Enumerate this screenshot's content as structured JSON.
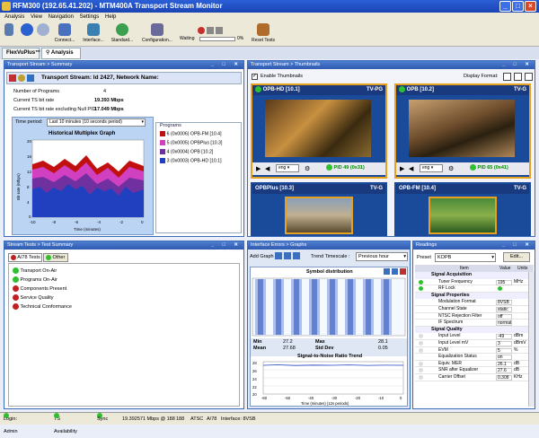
{
  "window": {
    "title": "RFM300 (192.65.41.202) - MTM400A Transport Stream Monitor"
  },
  "menu": [
    "Analysis",
    "View",
    "Navigation",
    "Settings",
    "Help"
  ],
  "toolbar": {
    "connect": "Connect...",
    "interface": "Interface...",
    "standard": "Standard...",
    "configuration": "Configuration...",
    "reset": "Reset Tests",
    "waiting": "Waiting",
    "progress": "0%"
  },
  "tabs": {
    "flexvuplus": "FlexVuPlus™",
    "analysis": "Analysis"
  },
  "summary": {
    "header": "Transport Stream > Summary",
    "ts_title": "Transport Stream: Id 2427, Network Name:",
    "rows": [
      {
        "label": "Number of Programs",
        "value": "4"
      },
      {
        "label": "Current TS bit rate",
        "value": "19.393 Mbps"
      },
      {
        "label": "Current TS bit rate excluding Null PID",
        "value": "17.049 Mbps"
      }
    ],
    "time_period_label": "Time period:",
    "time_period_value": "Last 10 minutes (10 seconds period)",
    "graph_title": "Historical Multiplex Graph",
    "ylabel": "Bit-rate (Mbps)",
    "xlabel": "Time (minutes)",
    "programs_label": "Programs",
    "programs": [
      {
        "label": "6 (0x0006) OPB-FM [10.4]",
        "color": "#c01010"
      },
      {
        "label": "5 (0x0005) OPBPlus [10.3]",
        "color": "#d040c0"
      },
      {
        "label": "4 (0x0004) OPB [10.2]",
        "color": "#7030a0"
      },
      {
        "label": "3 (0x0003) OPB-HD [10.1]",
        "color": "#2040c0"
      }
    ],
    "yticks": [
      "20",
      "18",
      "16",
      "14",
      "12",
      "10",
      "8",
      "6",
      "4",
      "2",
      "0"
    ],
    "xticks": [
      "-10",
      "-9",
      "-8",
      "-7",
      "-6",
      "-5",
      "-4",
      "-3",
      "-2",
      "-1",
      "0"
    ]
  },
  "thumbnails": {
    "header": "Transport Stream > Thumbnails",
    "enable_label": "Enable Thumbnails",
    "display_format": "Display Format:",
    "items": [
      {
        "name": "OPB-HD [10.1]",
        "rating": "TV-PG",
        "pid": "PID 49 (0x31)",
        "lang": "eng"
      },
      {
        "name": "OPB [10.2]",
        "rating": "TV-G",
        "pid": "PID 65 (0x41)",
        "lang": "eng"
      },
      {
        "name": "OPBPlus [10.3]",
        "rating": "TV-G"
      },
      {
        "name": "OPB-FM [10.4]",
        "rating": "TV-G"
      }
    ]
  },
  "tests": {
    "header": "Stream Tests > Test Summary",
    "tab1": "A/78 Tests",
    "tab2": "Other",
    "items": [
      {
        "label": "Transport On-Air",
        "status": "green"
      },
      {
        "label": "Programs On-Air",
        "status": "green"
      },
      {
        "label": "Components Present",
        "status": "red"
      },
      {
        "label": "Service Quality",
        "status": "red"
      },
      {
        "label": "Technical Conformance",
        "status": "red"
      }
    ]
  },
  "graphs": {
    "header": "Interface Errors > Graphs",
    "add_graph": "Add Graph",
    "trend_label": "Trend Timescale :",
    "trend_value": "Previous hour",
    "symbol_title": "Symbol distribution",
    "stats": [
      {
        "k": "Min",
        "v": "27.2"
      },
      {
        "k": "Max",
        "v": "28.1"
      },
      {
        "k": "Mean",
        "v": "27.68"
      },
      {
        "k": "Std Dev",
        "v": "0.05"
      }
    ],
    "snr_title": "Signal-to-Noise Ratio Trend",
    "snr_xlabel": "Time (minutes) (12s periods)",
    "snr_yticks": [
      "28",
      "26",
      "24",
      "22",
      "20"
    ],
    "snr_xticks": [
      "-60",
      "-50",
      "-40",
      "-30",
      "-20",
      "-10",
      "0"
    ]
  },
  "readings": {
    "header": "Readings",
    "preset_label": "Preset",
    "preset_value": "KOPB",
    "edit": "Edit...",
    "cols": [
      "Item",
      "Value",
      "Units"
    ],
    "rows": [
      {
        "type": "sec",
        "name": "Signal Acquisition"
      },
      {
        "type": "row",
        "name": "Tuner Frequency",
        "value": "195",
        "unit": "MHz"
      },
      {
        "type": "row",
        "name": "RF Lock",
        "value": "",
        "unit": "",
        "dot": "green"
      },
      {
        "type": "sec",
        "name": "Signal Properties"
      },
      {
        "type": "row",
        "name": "Modulation Format",
        "value": "8VSB",
        "unit": ""
      },
      {
        "type": "row",
        "name": "Channel State",
        "value": "static",
        "unit": ""
      },
      {
        "type": "row",
        "name": "NTSC Rejection Filter",
        "value": "off",
        "unit": ""
      },
      {
        "type": "row",
        "name": "IF Spectrum",
        "value": "normal",
        "unit": ""
      },
      {
        "type": "sec",
        "name": "Signal Quality"
      },
      {
        "type": "row",
        "name": "Input Level",
        "value": "-49",
        "unit": "dBm"
      },
      {
        "type": "row",
        "name": "Input Level mV",
        "value": "3",
        "unit": "dBmV"
      },
      {
        "type": "row",
        "name": "EVM",
        "value": "5",
        "unit": "%"
      },
      {
        "type": "row",
        "name": "Equalization Status",
        "value": "on",
        "unit": ""
      },
      {
        "type": "row",
        "name": "Equiv. MER",
        "value": "26.1",
        "unit": "dB"
      },
      {
        "type": "row",
        "name": "SNR after Equalizer",
        "value": "27.6",
        "unit": "dB"
      },
      {
        "type": "row",
        "name": "Carrier Offset",
        "value": "0.308",
        "unit": "KHz"
      }
    ]
  },
  "status": {
    "login": "Login: Admin",
    "ts_avail": "TS Availability",
    "sync": "Sync",
    "rate": "19.392571 Mbps @ 188",
    "pkt": "188",
    "std": "ATSC",
    "a78": "A/78",
    "iface": "Interface: 8VSB"
  }
}
